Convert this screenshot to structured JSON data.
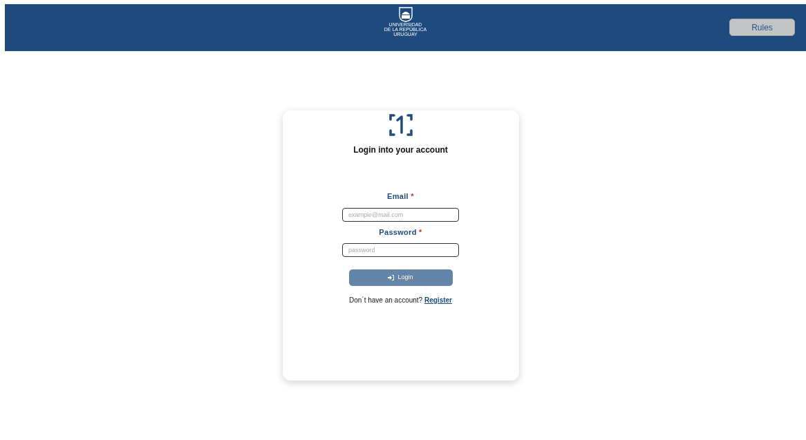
{
  "header": {
    "logo_lines": [
      "UNIVERSIDAD",
      "DE LA REPÚBLICA",
      "URUGUAY"
    ],
    "rules_button": "Rules"
  },
  "login": {
    "title": "Login into your account",
    "fields": [
      {
        "label": "Email",
        "required_mark": "*",
        "placeholder": "example@mail.com"
      },
      {
        "label": "Password",
        "required_mark": "*",
        "placeholder": "password"
      }
    ],
    "submit": {
      "label": "Login",
      "disabled": true
    },
    "register_prompt": "Don´t have an account?",
    "register_link": "Register"
  }
}
